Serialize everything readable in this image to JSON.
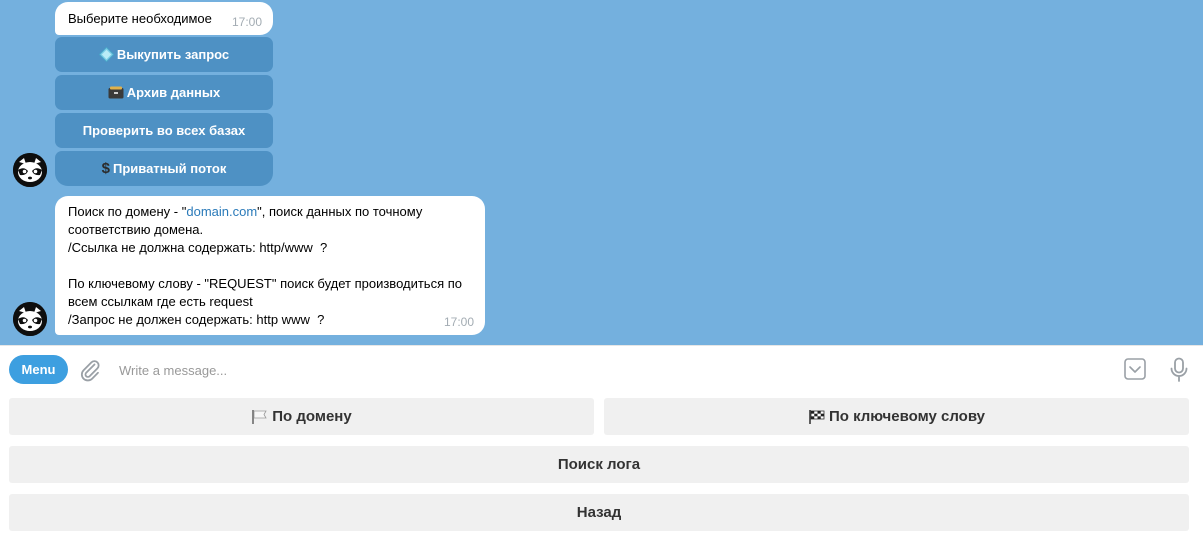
{
  "messages": [
    {
      "text": "Выберите необходимое",
      "time": "17:00",
      "inline_buttons": [
        {
          "label": "Выкупить запрос",
          "icon": "diamond-icon"
        },
        {
          "label": "Архив данных",
          "icon": "card-file-box-icon"
        },
        {
          "label": "Проверить во всех базах",
          "icon": ""
        },
        {
          "label": "Приватный поток",
          "icon": "dollar-icon"
        }
      ]
    },
    {
      "time": "17:00",
      "line1_prefix": "Поиск по домену - \"",
      "line1_link": "domain.com",
      "line1_suffix": "\", поиск данных по точному",
      "line2": "соответствию домена.",
      "line3": "/Ссылка не должна содержать: http/www  ?",
      "line4": "По ключевому слову - \"REQUEST\" поиск будет производиться по",
      "line5": "всем ссылкам где есть request",
      "line6": "/Запрос не должен содержать: http www  ?"
    }
  ],
  "composer": {
    "menu_label": "Menu",
    "placeholder": "Write a message..."
  },
  "reply_keyboard": [
    {
      "label": "По домену",
      "icon": "white-flag-icon"
    },
    {
      "label": "По ключевому слову",
      "icon": "checkered-flag-icon"
    },
    {
      "label": "Поиск лога",
      "icon": ""
    },
    {
      "label": "Назад",
      "icon": ""
    }
  ],
  "colors": {
    "chat_background": "#74b0de",
    "inline_button": "#4e91c4",
    "menu_button": "#3d9fe0",
    "link": "#2a7ab9",
    "reply_button": "#f0f0f0"
  }
}
